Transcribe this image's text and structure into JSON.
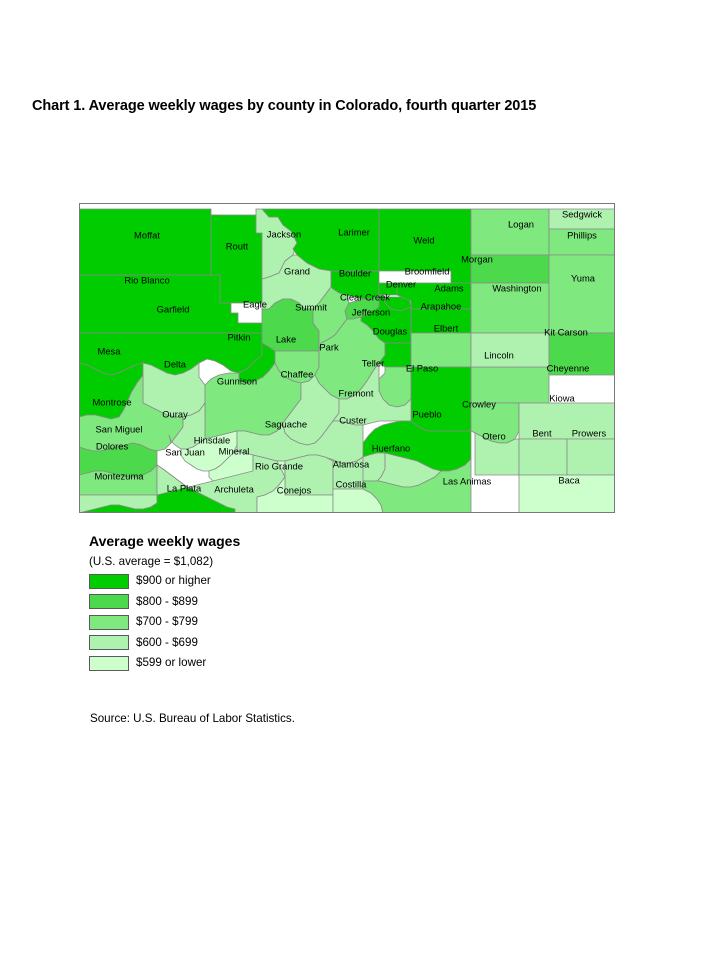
{
  "chart": {
    "title": "Chart 1. Average weekly wages by county in Colorado, fourth quarter 2015",
    "source": "Source: U.S. Bureau of Labor Statistics."
  },
  "legend": {
    "title": "Average weekly wages",
    "subtitle": "(U.S. average = $1,082)",
    "items": [
      {
        "label": "$900 or higher",
        "color": "#00CC00"
      },
      {
        "label": "$800 - $899",
        "color": "#4CD94C"
      },
      {
        "label": "$700 - $799",
        "color": "#7FE87F"
      },
      {
        "label": "$600 - $699",
        "color": "#AFF2AF"
      },
      {
        "label": "$599 or lower",
        "color": "#CCFFCC"
      }
    ]
  },
  "chart_data": {
    "type": "map",
    "title": "Chart 1. Average weekly wages by county in Colorado, fourth quarter 2015",
    "subtitle": "(U.S. average = $1,082)",
    "region": "Colorado",
    "measure": "Average weekly wages",
    "period": "fourth quarter 2015",
    "legend_position": "below-left",
    "bins": [
      {
        "label": "$900 or higher",
        "color": "#00CC00",
        "min": 900,
        "max": null
      },
      {
        "label": "$800 - $899",
        "color": "#4CD94C",
        "min": 800,
        "max": 899
      },
      {
        "label": "$700 - $799",
        "color": "#7FE87F",
        "min": 700,
        "max": 799
      },
      {
        "label": "$600 - $699",
        "color": "#AFF2AF",
        "min": 600,
        "max": 699
      },
      {
        "label": "$599 or lower",
        "color": "#CCFFCC",
        "min": null,
        "max": 599
      }
    ],
    "counties": [
      {
        "name": "Moffat",
        "bin": 0,
        "color": "#00CC00"
      },
      {
        "name": "Routt",
        "bin": 0,
        "color": "#00CC00"
      },
      {
        "name": "Jackson",
        "bin": 3,
        "color": "#AFF2AF"
      },
      {
        "name": "Larimer",
        "bin": 0,
        "color": "#00CC00"
      },
      {
        "name": "Weld",
        "bin": 0,
        "color": "#00CC00"
      },
      {
        "name": "Logan",
        "bin": 2,
        "color": "#7FE87F"
      },
      {
        "name": "Sedgwick",
        "bin": 3,
        "color": "#AFF2AF"
      },
      {
        "name": "Phillips",
        "bin": 2,
        "color": "#7FE87F"
      },
      {
        "name": "Rio Blanco",
        "bin": 0,
        "color": "#00CC00"
      },
      {
        "name": "Grand",
        "bin": 3,
        "color": "#AFF2AF"
      },
      {
        "name": "Boulder",
        "bin": 0,
        "color": "#00CC00"
      },
      {
        "name": "Broomfield",
        "bin": 0,
        "color": "#00CC00"
      },
      {
        "name": "Denver",
        "bin": 0,
        "color": "#00CC00"
      },
      {
        "name": "Adams",
        "bin": 0,
        "color": "#00CC00"
      },
      {
        "name": "Morgan",
        "bin": 1,
        "color": "#4CD94C"
      },
      {
        "name": "Washington",
        "bin": 2,
        "color": "#7FE87F"
      },
      {
        "name": "Yuma",
        "bin": 2,
        "color": "#7FE87F"
      },
      {
        "name": "Garfield",
        "bin": 0,
        "color": "#00CC00"
      },
      {
        "name": "Eagle",
        "bin": 1,
        "color": "#4CD94C"
      },
      {
        "name": "Summit",
        "bin": 2,
        "color": "#7FE87F"
      },
      {
        "name": "Clear Creek",
        "bin": 1,
        "color": "#4CD94C"
      },
      {
        "name": "Jefferson",
        "bin": 0,
        "color": "#00CC00"
      },
      {
        "name": "Arapahoe",
        "bin": 0,
        "color": "#00CC00"
      },
      {
        "name": "Mesa",
        "bin": 0,
        "color": "#00CC00"
      },
      {
        "name": "Delta",
        "bin": 3,
        "color": "#AFF2AF"
      },
      {
        "name": "Pitkin",
        "bin": 0,
        "color": "#00CC00"
      },
      {
        "name": "Lake",
        "bin": 2,
        "color": "#7FE87F"
      },
      {
        "name": "Park",
        "bin": 2,
        "color": "#7FE87F"
      },
      {
        "name": "Douglas",
        "bin": 0,
        "color": "#00CC00"
      },
      {
        "name": "Elbert",
        "bin": 2,
        "color": "#7FE87F"
      },
      {
        "name": "Kit Carson",
        "bin": 2,
        "color": "#7FE87F"
      },
      {
        "name": "Lincoln",
        "bin": 3,
        "color": "#AFF2AF"
      },
      {
        "name": "Cheyenne",
        "bin": 1,
        "color": "#4CD94C"
      },
      {
        "name": "Montrose",
        "bin": 2,
        "color": "#7FE87F"
      },
      {
        "name": "Gunnison",
        "bin": 2,
        "color": "#7FE87F"
      },
      {
        "name": "Chaffee",
        "bin": 3,
        "color": "#AFF2AF"
      },
      {
        "name": "Teller",
        "bin": 2,
        "color": "#7FE87F"
      },
      {
        "name": "El Paso",
        "bin": 0,
        "color": "#00CC00"
      },
      {
        "name": "Fremont",
        "bin": 3,
        "color": "#AFF2AF"
      },
      {
        "name": "Pueblo",
        "bin": 0,
        "color": "#00CC00"
      },
      {
        "name": "Crowley",
        "bin": 2,
        "color": "#7FE87F"
      },
      {
        "name": "Kiowa",
        "bin": 3,
        "color": "#AFF2AF"
      },
      {
        "name": "Ouray",
        "bin": 3,
        "color": "#AFF2AF"
      },
      {
        "name": "San Miguel",
        "bin": 1,
        "color": "#4CD94C"
      },
      {
        "name": "Hinsdale",
        "bin": 4,
        "color": "#CCFFCC"
      },
      {
        "name": "Saguache",
        "bin": 3,
        "color": "#AFF2AF"
      },
      {
        "name": "Custer",
        "bin": 3,
        "color": "#AFF2AF"
      },
      {
        "name": "Otero",
        "bin": 3,
        "color": "#AFF2AF"
      },
      {
        "name": "Bent",
        "bin": 3,
        "color": "#AFF2AF"
      },
      {
        "name": "Prowers",
        "bin": 3,
        "color": "#AFF2AF"
      },
      {
        "name": "Dolores",
        "bin": 2,
        "color": "#7FE87F"
      },
      {
        "name": "San Juan",
        "bin": 4,
        "color": "#CCFFCC"
      },
      {
        "name": "Mineral",
        "bin": 4,
        "color": "#CCFFCC"
      },
      {
        "name": "Rio Grande",
        "bin": 3,
        "color": "#AFF2AF"
      },
      {
        "name": "Alamosa",
        "bin": 3,
        "color": "#AFF2AF"
      },
      {
        "name": "Huerfano",
        "bin": 3,
        "color": "#AFF2AF"
      },
      {
        "name": "Montezuma",
        "bin": 3,
        "color": "#AFF2AF"
      },
      {
        "name": "La Plata",
        "bin": 0,
        "color": "#00CC00"
      },
      {
        "name": "Archuleta",
        "bin": 3,
        "color": "#AFF2AF"
      },
      {
        "name": "Conejos",
        "bin": 4,
        "color": "#CCFFCC"
      },
      {
        "name": "Costilla",
        "bin": 4,
        "color": "#CCFFCC"
      },
      {
        "name": "Las Animas",
        "bin": 2,
        "color": "#7FE87F"
      },
      {
        "name": "Baca",
        "bin": 4,
        "color": "#CCFFCC"
      }
    ]
  }
}
